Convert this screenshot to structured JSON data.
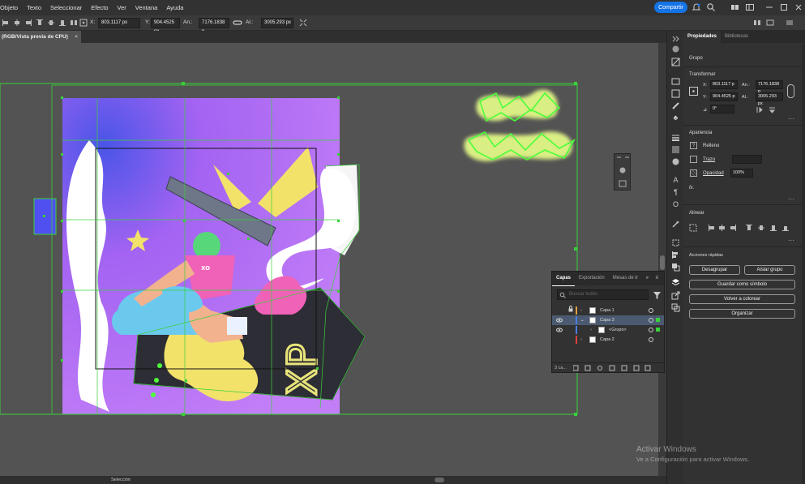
{
  "menubar": {
    "items": [
      "Objeto",
      "Texto",
      "Seleccionar",
      "Efecto",
      "Ver",
      "Ventana",
      "Ayuda"
    ],
    "share_label": "Compartir"
  },
  "controlbar": {
    "x_label": "X:",
    "x_value": "803.1117 px",
    "y_label": "Y:",
    "y_value": "904.4525 px",
    "w_label": "An.:",
    "w_value": "7176.1838 p",
    "h_label": "Al.:",
    "h_value": "3005.293 px"
  },
  "document": {
    "tab_title": "(RGB/Vista previa de CPU)",
    "close_glyph": "×"
  },
  "layers_panel": {
    "tabs": [
      "Capas",
      "Exportación",
      "Mesas de tr"
    ],
    "active_tab": "Capas",
    "search_placeholder": "Buscar todos",
    "layers": [
      {
        "name": "Capa 1",
        "color": "#e0a040",
        "visible": false,
        "locked": true,
        "expanded": false,
        "selected": false
      },
      {
        "name": "Capa 3",
        "color": "#4a7de0",
        "visible": true,
        "locked": false,
        "expanded": true,
        "selected": true
      },
      {
        "name": "<Grupo>",
        "color": "#4a7de0",
        "visible": true,
        "locked": false,
        "expanded": false,
        "selected": false
      },
      {
        "name": "Capa 2",
        "color": "#e04040",
        "visible": false,
        "locked": false,
        "expanded": false,
        "selected": false
      }
    ],
    "footer_label": "3 ca..."
  },
  "properties_panel": {
    "tabs": [
      "Propiedades",
      "Bibliotecas"
    ],
    "active_tab": "Propiedades",
    "object_type": "Grupo",
    "transform": {
      "title": "Transformar",
      "x_label": "X:",
      "x_value": "803.1117 p",
      "y_label": "Y:",
      "y_value": "904.4525 p",
      "w_label": "An.:",
      "w_value": "7176.1838 p",
      "h_label": "Al.:",
      "h_value": "3005.293 px",
      "angle_value": "0°"
    },
    "appearance": {
      "title": "Apariencia",
      "fill_label": "Relleno",
      "stroke_label": "Trazo",
      "opacity_label": "Opacidad",
      "opacity_value": "100%",
      "fx_label": "fx."
    },
    "align": {
      "title": "Alinear"
    },
    "quick_actions": {
      "title": "Acciones rápidas",
      "ungroup": "Desagrupar",
      "isolate": "Aislar grupo",
      "save_symbol": "Guardar como símbolo",
      "recolor": "Volver a colorear",
      "arrange": "Organizar"
    }
  },
  "statusbar": {
    "selection_label": "Selección"
  },
  "watermark": {
    "line1": "Activar Windows",
    "line2": "Ve a Configuración para activar Windows."
  },
  "colors": {
    "accent": "#1473e6",
    "selection_green": "#3ad13a",
    "artboard_purple": "#b36ef5",
    "panel_bg": "#323232"
  }
}
